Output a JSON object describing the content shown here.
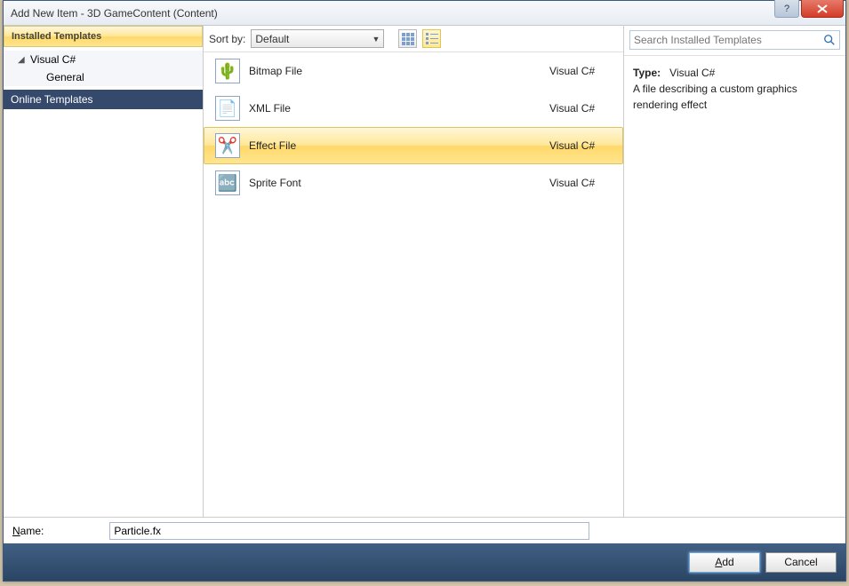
{
  "titlebar": {
    "title": "Add New Item - 3D GameContent (Content)"
  },
  "sidebar": {
    "header": "Installed Templates",
    "root": "Visual C#",
    "child": "General",
    "online": "Online Templates"
  },
  "toolbar": {
    "sort_label": "Sort by:",
    "sort_value": "Default"
  },
  "templates": [
    {
      "label": "Bitmap File",
      "lang": "Visual C#",
      "icon": "🌵"
    },
    {
      "label": "XML File",
      "lang": "Visual C#",
      "icon": "📄"
    },
    {
      "label": "Effect File",
      "lang": "Visual C#",
      "icon": "✂️",
      "selected": true
    },
    {
      "label": "Sprite Font",
      "lang": "Visual C#",
      "icon": "🔤"
    }
  ],
  "search": {
    "placeholder": "Search Installed Templates"
  },
  "info": {
    "type_label": "Type:",
    "type_value": "Visual C#",
    "description": "A file describing a custom graphics rendering effect"
  },
  "nameRow": {
    "label_prefix": "N",
    "label_rest": "ame:",
    "value": "Particle.fx"
  },
  "buttons": {
    "add_prefix": "A",
    "add_rest": "dd",
    "cancel": "Cancel"
  }
}
